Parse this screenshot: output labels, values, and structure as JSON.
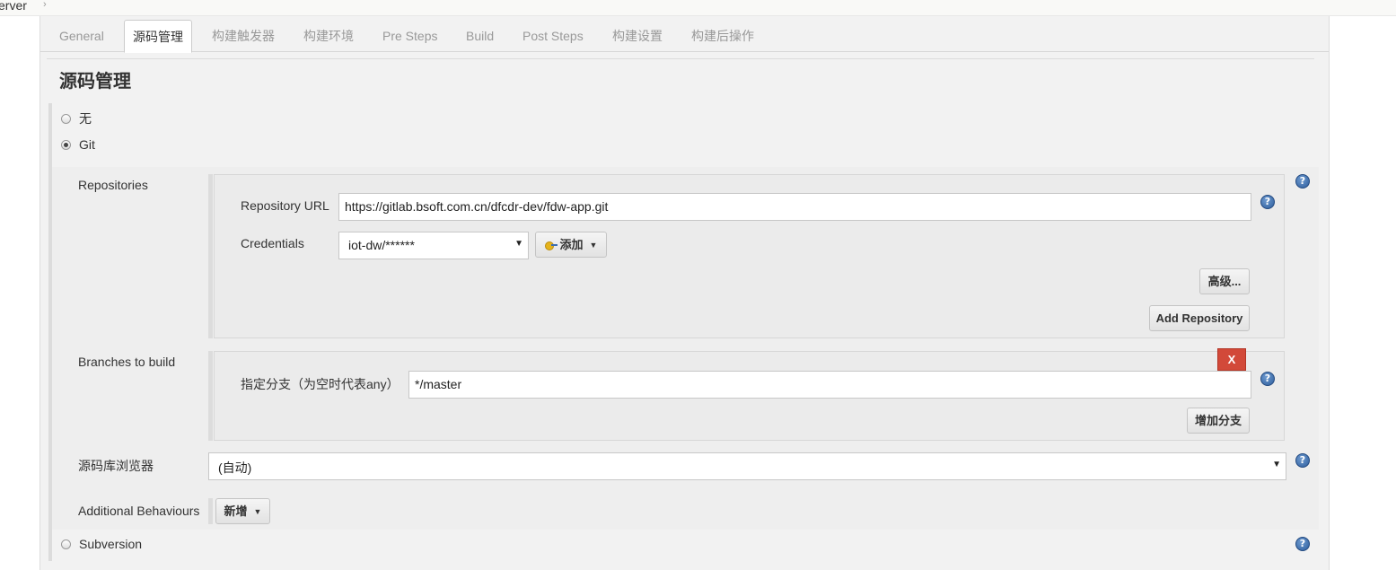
{
  "breadcrumb": {
    "text": "erver",
    "arrow": "›"
  },
  "tabs": [
    "General",
    "源码管理",
    "构建触发器",
    "构建环境",
    "Pre Steps",
    "Build",
    "Post Steps",
    "构建设置",
    "构建后操作"
  ],
  "section_title": "源码管理",
  "scm_options": {
    "none": "无",
    "git": "Git",
    "subversion": "Subversion"
  },
  "repositories": {
    "label": "Repositories",
    "url_label": "Repository URL",
    "url_value": "https://gitlab.bsoft.com.cn/dfcdr-dev/fdw-app.git",
    "credentials_label": "Credentials",
    "credentials_value": "iot-dw/******",
    "add_button": "添加",
    "advanced_button": "高级...",
    "add_repository_button": "Add Repository"
  },
  "branches": {
    "label": "Branches to build",
    "branch_label": "指定分支（为空时代表any）",
    "branch_value": "*/master",
    "delete_button": "X",
    "add_branch_button": "增加分支"
  },
  "browser": {
    "label": "源码库浏览器",
    "value": "(自动)"
  },
  "behaviours": {
    "label": "Additional Behaviours",
    "add_button": "新增"
  },
  "help_glyph": "?",
  "colors": {
    "delete": "#d24939",
    "help": "#2d5d9c",
    "panel_bg": "#f2f2f2"
  }
}
